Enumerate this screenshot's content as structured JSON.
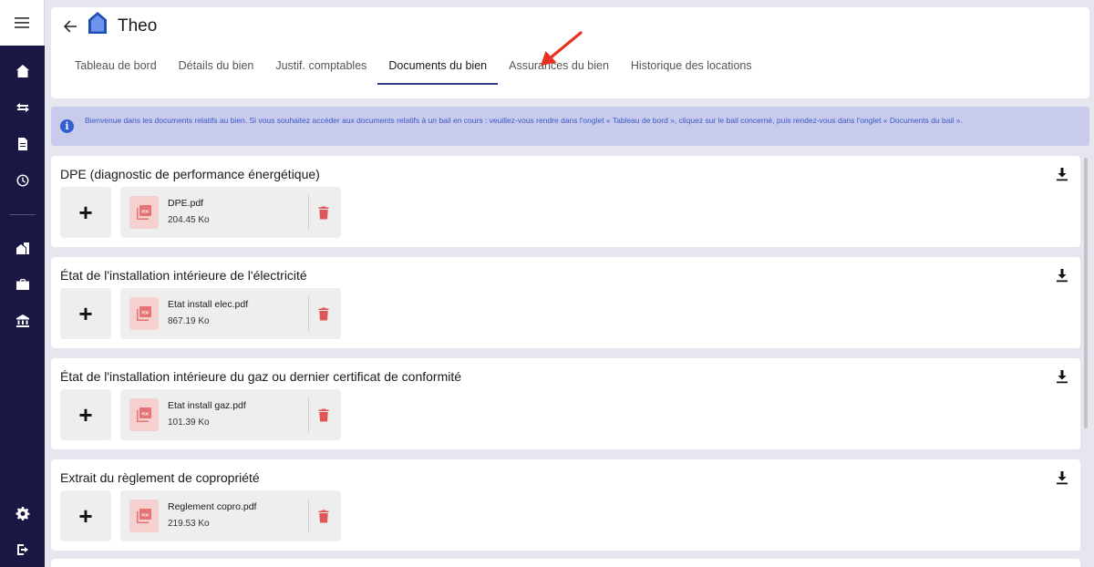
{
  "header": {
    "title": "Theo",
    "tabs": [
      {
        "label": "Tableau de bord"
      },
      {
        "label": "Détails du bien"
      },
      {
        "label": "Justif. comptables"
      },
      {
        "label": "Documents du bien"
      },
      {
        "label": "Assurances du bien"
      },
      {
        "label": "Historique des locations"
      }
    ],
    "active_tab_index": 3
  },
  "info_banner": {
    "icon": "info-icon",
    "text": "Bienvenue dans les documents relatifs au bien.  Si vous souhaitez accéder aux documents relatifs à un bail en cours : veuillez-vous rendre dans l'onglet « Tableau de bord », cliquez sur le bail concerné, puis rendez-vous dans l'onglet « Documents du bail »."
  },
  "sidebar": {
    "icons": [
      "menu-icon",
      "home-icon",
      "swap-icon",
      "document-icon",
      "clock-icon",
      "buildings-icon",
      "briefcase-icon",
      "bank-icon",
      "settings-icon",
      "logout-icon"
    ]
  },
  "sections": [
    {
      "title": "DPE (diagnostic de performance énergétique)",
      "file": {
        "name": "DPE.pdf",
        "size": "204.45 Ko"
      }
    },
    {
      "title": "État de l'installation intérieure de l'électricité",
      "file": {
        "name": "Etat install elec.pdf",
        "size": "867.19 Ko"
      }
    },
    {
      "title": "État de l'installation intérieure du gaz ou dernier certificat de conformité",
      "file": {
        "name": "Etat install gaz.pdf",
        "size": "101.39 Ko"
      }
    },
    {
      "title": "Extrait du règlement de copropriété",
      "file": {
        "name": "Reglement copro.pdf",
        "size": "219.53 Ko"
      }
    }
  ],
  "colors": {
    "sidebar_bg": "#1a1744",
    "accent": "#3b3b8c",
    "info_bg": "#c8cbec",
    "info_text": "#3c58c8",
    "delete": "#e05555",
    "annotation_arrow": "#e8321e"
  }
}
